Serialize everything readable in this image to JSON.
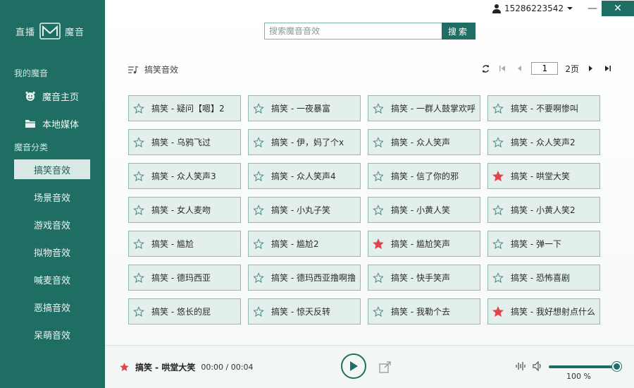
{
  "app": {
    "logo_left": "直播",
    "logo_right": "魔音"
  },
  "user": {
    "phone": "15286223542"
  },
  "window": {
    "minimize": "—",
    "close": "✕"
  },
  "sidebar": {
    "section_my": "我的魔音",
    "my_items": [
      {
        "label": "魔音主页",
        "icon": "smile-icon"
      },
      {
        "label": "本地媒体",
        "icon": "folder-icon"
      }
    ],
    "section_cat": "魔音分类",
    "categories": [
      {
        "label": "搞笑音效",
        "active": true
      },
      {
        "label": "场景音效"
      },
      {
        "label": "游戏音效"
      },
      {
        "label": "拟物音效"
      },
      {
        "label": "喊麦音效"
      },
      {
        "label": "恶搞音效"
      },
      {
        "label": "呆萌音效"
      }
    ]
  },
  "search": {
    "placeholder": "搜索魔音音效",
    "value": "",
    "button": "搜索"
  },
  "list": {
    "title": "搞笑音效"
  },
  "pager": {
    "current": "1",
    "total": "2页"
  },
  "sounds": [
    {
      "label": "搞笑 - 疑问【嗯】2",
      "fav": false
    },
    {
      "label": "搞笑 - 一夜暴富",
      "fav": false
    },
    {
      "label": "搞笑 - 一群人鼓掌欢呼",
      "fav": false
    },
    {
      "label": "搞笑 - 不要啊惨叫",
      "fav": false
    },
    {
      "label": "搞笑 - 乌鸦飞过",
      "fav": false
    },
    {
      "label": "搞笑 - 伊，妈了个x",
      "fav": false
    },
    {
      "label": "搞笑 - 众人笑声",
      "fav": false
    },
    {
      "label": "搞笑 - 众人笑声2",
      "fav": false
    },
    {
      "label": "搞笑 - 众人笑声3",
      "fav": false
    },
    {
      "label": "搞笑 - 众人笑声4",
      "fav": false
    },
    {
      "label": "搞笑 - 信了你的邪",
      "fav": false
    },
    {
      "label": "搞笑 - 哄堂大笑",
      "fav": true
    },
    {
      "label": "搞笑 - 女人麦吻",
      "fav": false
    },
    {
      "label": "搞笑 - 小丸子笑",
      "fav": false
    },
    {
      "label": "搞笑 - 小黄人笑",
      "fav": false
    },
    {
      "label": "搞笑 - 小黄人笑2",
      "fav": false
    },
    {
      "label": "搞笑 - 尴尬",
      "fav": false
    },
    {
      "label": "搞笑 - 尴尬2",
      "fav": false
    },
    {
      "label": "搞笑 - 尴尬笑声",
      "fav": true
    },
    {
      "label": "搞笑 - 弹一下",
      "fav": false
    },
    {
      "label": "搞笑 - 德玛西亚",
      "fav": false
    },
    {
      "label": "搞笑 - 德玛西亚撸啊撸",
      "fav": false
    },
    {
      "label": "搞笑 - 快手笑声",
      "fav": false
    },
    {
      "label": "搞笑 - 恐怖喜剧",
      "fav": false
    },
    {
      "label": "搞笑 - 悠长的屁",
      "fav": false
    },
    {
      "label": "搞笑 - 惊天反转",
      "fav": false
    },
    {
      "label": "搞笑 - 我勒个去",
      "fav": false
    },
    {
      "label": "搞笑 - 我好想射点什么",
      "fav": true
    }
  ],
  "player": {
    "now_title": "搞笑 - 哄堂大笑",
    "time": "00:00 / 00:04",
    "volume_label": "100 %",
    "volume_fraction": 1.0
  },
  "colors": {
    "accent": "#1f6e63",
    "fav_star": "#e0454b",
    "card_bg": "#e3efec"
  }
}
